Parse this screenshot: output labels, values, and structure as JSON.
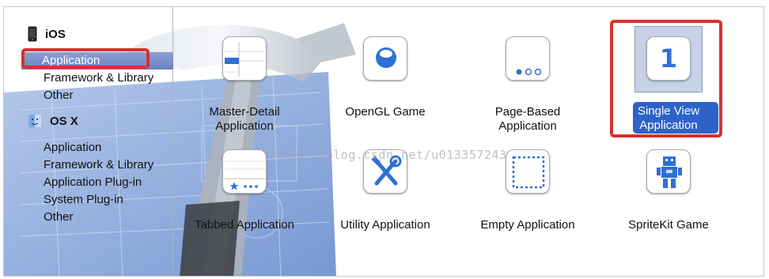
{
  "sidebar": {
    "platforms": [
      {
        "name": "iOS",
        "icon": "iphone-icon",
        "items": [
          {
            "label": "Application",
            "selected": true
          },
          {
            "label": "Framework & Library",
            "selected": false
          },
          {
            "label": "Other",
            "selected": false
          }
        ]
      },
      {
        "name": "OS X",
        "icon": "finder-icon",
        "items": [
          {
            "label": "Application",
            "selected": false
          },
          {
            "label": "Framework & Library",
            "selected": false
          },
          {
            "label": "Application Plug-in",
            "selected": false
          },
          {
            "label": "System Plug-in",
            "selected": false
          },
          {
            "label": "Other",
            "selected": false
          }
        ]
      }
    ]
  },
  "templates": [
    {
      "label": "Master-Detail Application",
      "line1": "Master-Detail",
      "line2": "Application",
      "icon": "master-detail-icon",
      "selected": false
    },
    {
      "label": "OpenGL Game",
      "line1": "OpenGL Game",
      "line2": "",
      "icon": "opengl-sphere-icon",
      "selected": false
    },
    {
      "label": "Page-Based Application",
      "line1": "Page-Based",
      "line2": "Application",
      "icon": "page-dots-icon",
      "selected": false
    },
    {
      "label": "Single View Application",
      "line1": "Single View",
      "line2": "Application",
      "icon": "single-view-icon",
      "icon_text": "1",
      "selected": true
    },
    {
      "label": "Tabbed Application",
      "line1": "Tabbed Application",
      "line2": "",
      "icon": "tab-bar-icon",
      "selected": false
    },
    {
      "label": "Utility Application",
      "line1": "Utility Application",
      "line2": "",
      "icon": "tools-icon",
      "selected": false
    },
    {
      "label": "Empty Application",
      "line1": "Empty Application",
      "line2": "",
      "icon": "empty-dashed-icon",
      "selected": false
    },
    {
      "label": "SpriteKit Game",
      "line1": "SpriteKit Game",
      "line2": "",
      "icon": "sprite-robot-icon",
      "selected": false
    }
  ],
  "watermark": "http://blog.csdn.net/u013357243",
  "colors": {
    "selection_blue": "#2f62c8",
    "sidebar_selected": "#7489c6",
    "annotation_red": "#d9302f",
    "icon_blue": "#2f6fd6"
  }
}
